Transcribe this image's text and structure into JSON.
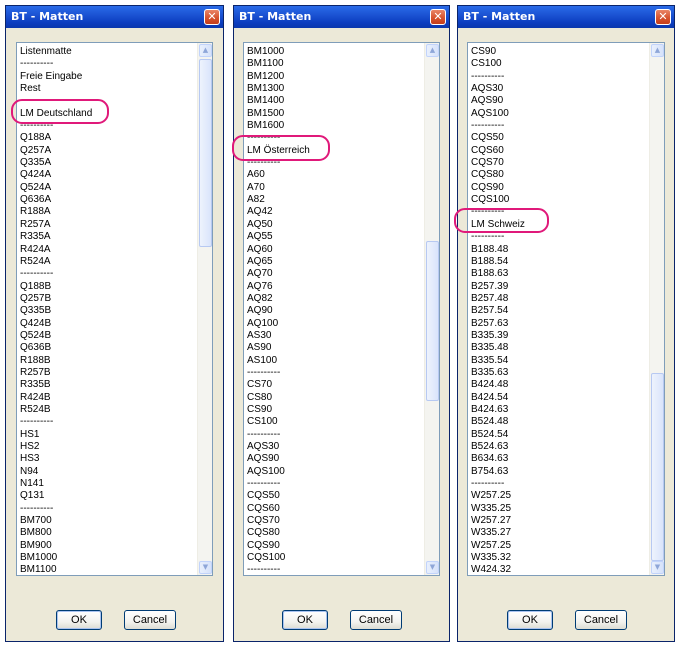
{
  "dialogs": [
    {
      "title": "BT - Matten",
      "close_glyph": "✕",
      "items": [
        "Listenmatte",
        "----------",
        "Freie Eingabe",
        "Rest",
        "----------",
        "LM Deutschland",
        "----------",
        "Q188A",
        "Q257A",
        "Q335A",
        "Q424A",
        "Q524A",
        "Q636A",
        "R188A",
        "R257A",
        "R335A",
        "R424A",
        "R524A",
        "----------",
        "Q188B",
        "Q257B",
        "Q335B",
        "Q424B",
        "Q524B",
        "Q636B",
        "R188B",
        "R257B",
        "R335B",
        "R424B",
        "R524B",
        "----------",
        "HS1",
        "HS2",
        "HS3",
        "N94",
        "N141",
        "Q131",
        "----------",
        "BM700",
        "BM800",
        "BM900",
        "BM1000",
        "BM1100"
      ],
      "ok_label": "OK",
      "cancel_label": "Cancel"
    },
    {
      "title": "BT - Matten",
      "close_glyph": "✕",
      "items": [
        "BM1000",
        "BM1100",
        "BM1200",
        "BM1300",
        "BM1400",
        "BM1500",
        "BM1600",
        "----------",
        "LM Österreich",
        "----------",
        "A60",
        "A70",
        "A82",
        "AQ42",
        "AQ50",
        "AQ55",
        "AQ60",
        "AQ65",
        "AQ70",
        "AQ76",
        "AQ82",
        "AQ90",
        "AQ100",
        "AS30",
        "AS90",
        "AS100",
        "----------",
        "CS70",
        "CS80",
        "CS90",
        "CS100",
        "----------",
        "AQS30",
        "AQS90",
        "AQS100",
        "----------",
        "CQS50",
        "CQS60",
        "CQS70",
        "CQS80",
        "CQS90",
        "CQS100",
        "----------"
      ],
      "ok_label": "OK",
      "cancel_label": "Cancel"
    },
    {
      "title": "BT - Matten",
      "close_glyph": "✕",
      "items": [
        "CS90",
        "CS100",
        "----------",
        "AQS30",
        "AQS90",
        "AQS100",
        "----------",
        "CQS50",
        "CQS60",
        "CQS70",
        "CQS80",
        "CQS90",
        "CQS100",
        "----------",
        "LM Schweiz",
        "----------",
        "B188.48",
        "B188.54",
        "B188.63",
        "B257.39",
        "B257.48",
        "B257.54",
        "B257.63",
        "B335.39",
        "B335.48",
        "B335.54",
        "B335.63",
        "B424.48",
        "B424.54",
        "B424.63",
        "B524.48",
        "B524.54",
        "B524.63",
        "B634.63",
        "B754.63",
        "----------",
        "W257.25",
        "W335.25",
        "W257.27",
        "W335.27",
        "W257.25",
        "W335.32",
        "W424.32"
      ],
      "ok_label": "OK",
      "cancel_label": "Cancel"
    }
  ],
  "highlight_color": "#e0197a",
  "icons": {
    "close": "close-icon",
    "scroll_up": "scroll-up-arrow-icon",
    "scroll_down": "scroll-down-arrow-icon"
  }
}
